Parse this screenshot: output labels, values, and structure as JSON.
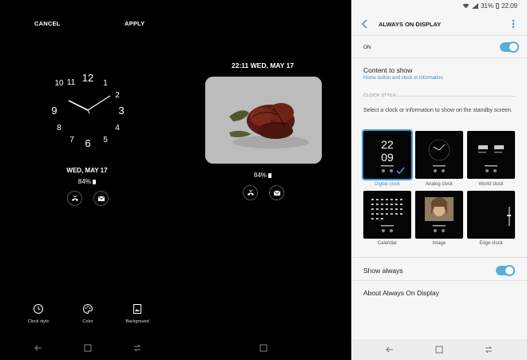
{
  "panel1": {
    "cancel_label": "CANCEL",
    "apply_label": "APPLY",
    "clock_numbers": [
      "12",
      "1",
      "2",
      "3",
      "4",
      "5",
      "6",
      "7",
      "8",
      "9",
      "10",
      "11"
    ],
    "date": "WED, MAY 17",
    "battery": "84%",
    "tools": [
      {
        "label": "Clock style",
        "icon": "clock-icon"
      },
      {
        "label": "Color",
        "icon": "palette-icon"
      },
      {
        "label": "Background",
        "icon": "image-icon"
      }
    ]
  },
  "panel2": {
    "date_time": "22:11  WED, MAY 17",
    "battery": "84%"
  },
  "panel3": {
    "status": {
      "battery_pct": "31%",
      "time": "22:09"
    },
    "title": "ALWAYS ON DISPLAY",
    "on_label": "ON",
    "content_title": "Content to show",
    "content_sub": "Home button and clock or information",
    "section_header": "CLOCK STYLE",
    "description": "Select a clock or information to show on the standby screen.",
    "styles": [
      {
        "label": "Digital clock",
        "selected": true
      },
      {
        "label": "Analog clock",
        "selected": false
      },
      {
        "label": "World clock",
        "selected": false
      },
      {
        "label": "Calendar",
        "selected": false
      },
      {
        "label": "Image",
        "selected": false
      },
      {
        "label": "Edge clock",
        "selected": false
      }
    ],
    "digital_preview": {
      "hour": "22",
      "minute": "09"
    },
    "show_always_label": "Show always",
    "about_label": "About Always On Display"
  },
  "colors": {
    "accent": "#5aaed6",
    "link": "#3a8fc9",
    "dark_bg": "#000000",
    "light_bg": "#f6f6f6"
  }
}
